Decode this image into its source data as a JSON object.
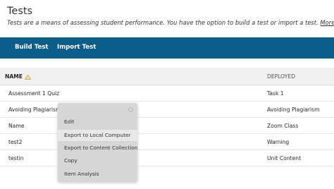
{
  "page": {
    "title": "Tests",
    "description": "Tests are a means of assessing student performance. You have the option to build a test or import a test.",
    "help_link": "More Help"
  },
  "toolbar": {
    "build_label": "Build Test",
    "import_label": "Import Test"
  },
  "table": {
    "columns": [
      "NAME",
      "DEPLOYED"
    ],
    "sort_icon": "sort-ascending-icon",
    "rows": [
      {
        "name": "Assessment 1 Quiz",
        "deployed": "Task 1"
      },
      {
        "name": "Avoiding Plagiarism",
        "deployed": "Avoiding Plagiarism"
      },
      {
        "name": "Name",
        "deployed": "Zoom Class"
      },
      {
        "name": "test2",
        "deployed": "Warning"
      },
      {
        "name": "testin",
        "deployed": "Unit Content"
      }
    ]
  },
  "context_menu": {
    "close_icon": "close-icon",
    "items": [
      "Edit",
      "Export to Local Computer",
      "Export to Content Collection",
      "Copy",
      "Item Analysis"
    ],
    "highlighted": "Export to Local Computer"
  },
  "colors": {
    "toolbar": "#0b5e8a",
    "menu": "#d6d6d6",
    "header": "#f0f0f0"
  }
}
